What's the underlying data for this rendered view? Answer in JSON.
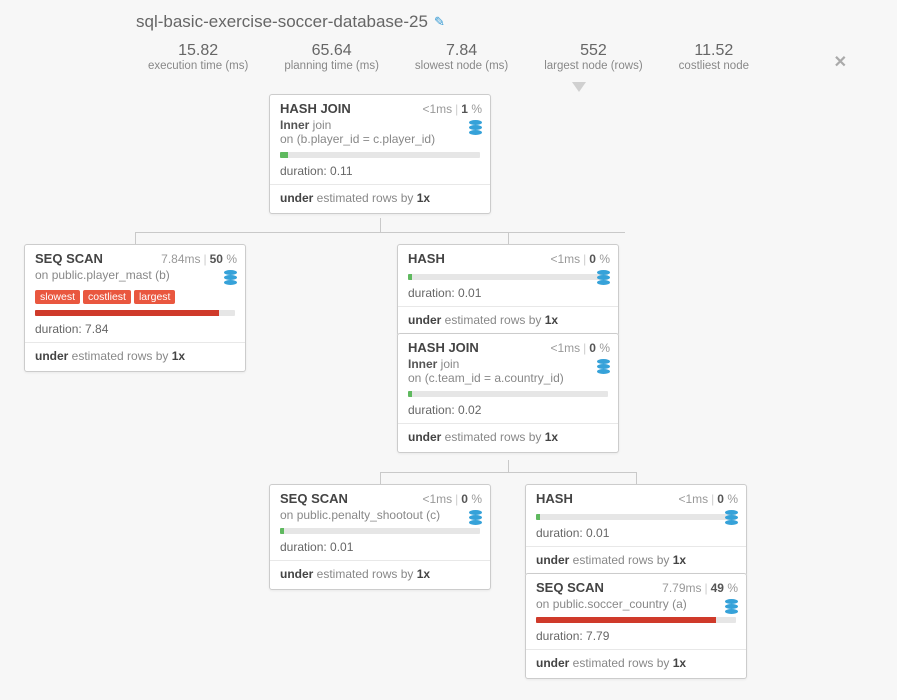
{
  "title": "sql-basic-exercise-soccer-database-25",
  "stats": [
    {
      "value": "15.82",
      "label": "execution time (ms)"
    },
    {
      "value": "65.64",
      "label": "planning time (ms)"
    },
    {
      "value": "7.84",
      "label": "slowest node (ms)"
    },
    {
      "value": "552",
      "label": "largest node (rows)"
    },
    {
      "value": "11.52",
      "label": "costliest node"
    }
  ],
  "text": {
    "duration_prefix": "duration: ",
    "under": "under",
    "est_mid": " estimated rows by ",
    "one_x": "1x",
    "inner_b": "Inner",
    "inner_a": " join",
    "on_prefix": "on "
  },
  "nodes": {
    "n1": {
      "type": "HASH JOIN",
      "time": "<1ms",
      "pct": "1",
      "join_cond": "(b.player_id = c.player_id)",
      "dur": "0.11",
      "barClass": "bar-green",
      "barW": "4%"
    },
    "n2": {
      "type": "SEQ SCAN",
      "time": "7.84ms",
      "pct": "50",
      "table": "public.player_mast (b)",
      "dur": "7.84",
      "barClass": "bar-red",
      "barW": "92%",
      "tags": [
        "slowest",
        "costliest",
        "largest"
      ]
    },
    "n3": {
      "type": "HASH",
      "time": "<1ms",
      "pct": "0",
      "dur": "0.01",
      "barClass": "bar-green",
      "barW": "2%"
    },
    "n4": {
      "type": "HASH JOIN",
      "time": "<1ms",
      "pct": "0",
      "join_cond": "(c.team_id = a.country_id)",
      "dur": "0.02",
      "barClass": "bar-green",
      "barW": "2%"
    },
    "n5": {
      "type": "SEQ SCAN",
      "time": "<1ms",
      "pct": "0",
      "table": "public.penalty_shootout (c)",
      "dur": "0.01",
      "barClass": "bar-green",
      "barW": "2%"
    },
    "n6": {
      "type": "HASH",
      "time": "<1ms",
      "pct": "0",
      "dur": "0.01",
      "barClass": "bar-green",
      "barW": "2%"
    },
    "n7": {
      "type": "SEQ SCAN",
      "time": "7.79ms",
      "pct": "49",
      "table": "public.soccer_country (a)",
      "dur": "7.79",
      "barClass": "bar-red",
      "barW": "90%"
    }
  }
}
